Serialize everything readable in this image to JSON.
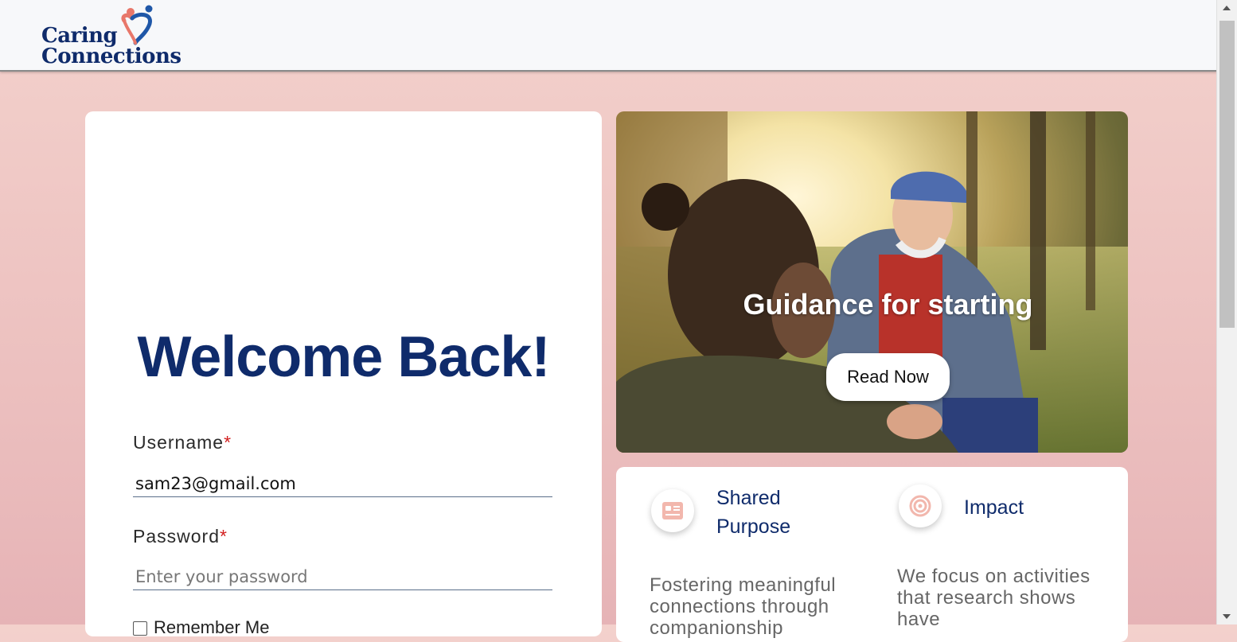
{
  "header": {
    "logo_line1": "Caring",
    "logo_line2": "Connections"
  },
  "login": {
    "title": "Welcome Back!",
    "username_label": "Username",
    "username_value": "sam23@gmail.com",
    "password_label": "Password",
    "password_placeholder": "Enter your password",
    "required_mark": "*",
    "remember_label": "Remember Me"
  },
  "hero": {
    "heading": "Guidance for starting",
    "button_label": "Read Now"
  },
  "features": [
    {
      "title": "Shared Purpose",
      "icon": "id-card-icon",
      "description": "Fostering meaningful connections through companionship"
    },
    {
      "title": "Impact",
      "icon": "target-icon",
      "description": "We focus on activities that research shows have"
    }
  ],
  "colors": {
    "brand_navy": "#0f2b6b",
    "accent_coral": "#e8776a",
    "required_red": "#d21f1f"
  }
}
